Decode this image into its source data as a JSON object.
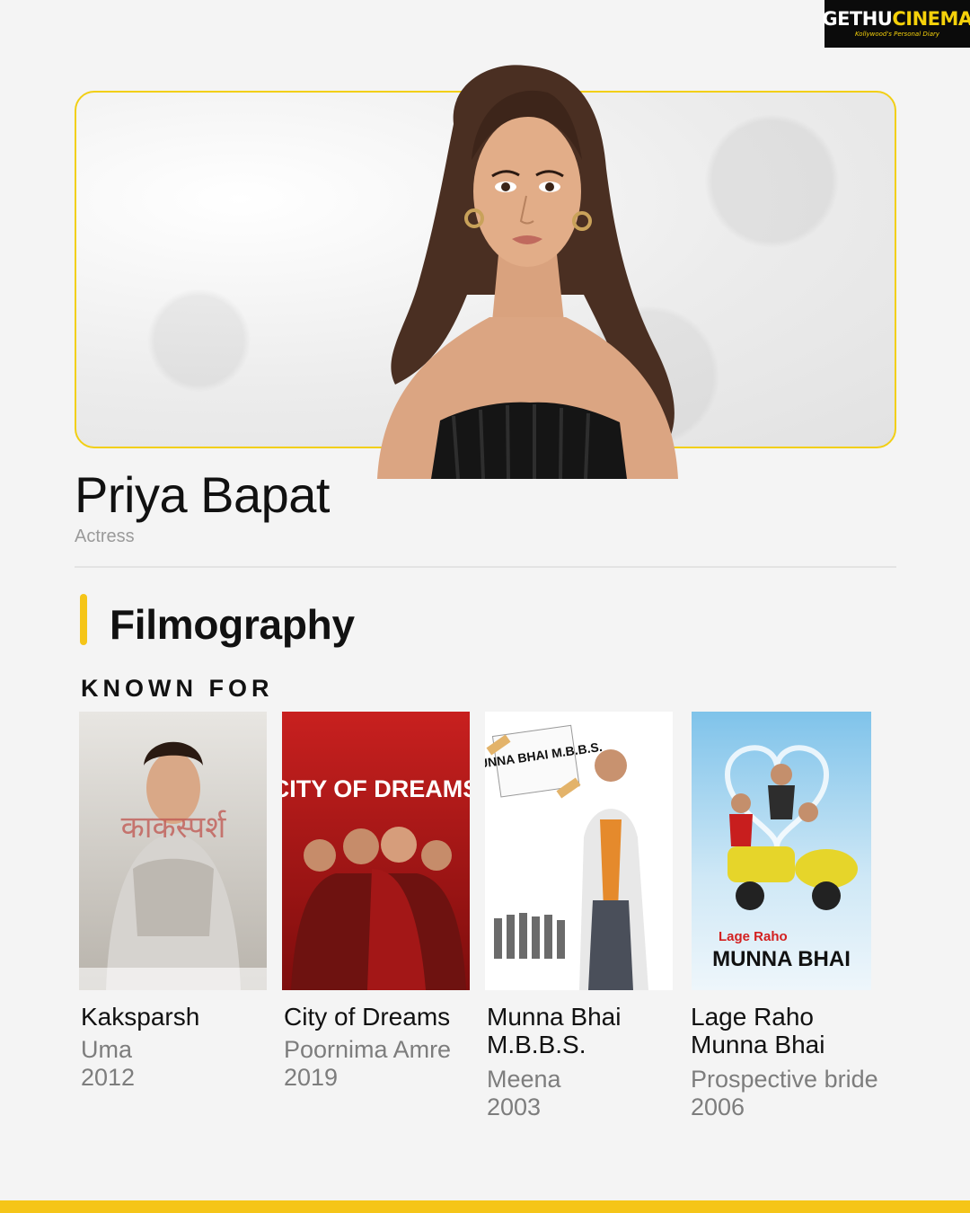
{
  "watermark": {
    "brand_part1": "GETHU",
    "brand_part2": "CINEMA",
    "tagline": "Kollywood's Personal Diary"
  },
  "person": {
    "name": "Priya Bapat",
    "role": "Actress"
  },
  "section": {
    "title": "Filmography",
    "subtitle": "KNOWN FOR"
  },
  "films": [
    {
      "title": "Kaksparsh",
      "role": "Uma",
      "year": "2012",
      "poster_text": "काकस्पर्श",
      "poster_colors": [
        "#e8e6e2",
        "#b8b3ab"
      ]
    },
    {
      "title": "City of Dreams",
      "role": "Poornima Amre",
      "year": "2019",
      "poster_text": "CITY OF DREAMS",
      "poster_colors": [
        "#c8201f",
        "#7e0d0d"
      ]
    },
    {
      "title": "Munna Bhai M.B.B.S.",
      "role": "Meena",
      "year": "2003",
      "poster_text": "MUNNA BHAI M.B.B.S.",
      "poster_colors": [
        "#ffffff",
        "#eaeaea"
      ]
    },
    {
      "title": "Lage Raho Munna Bhai",
      "role": "Prospective bride",
      "year": "2006",
      "poster_text_top": "Lage Raho",
      "poster_text": "MUNNA BHAI",
      "poster_colors": [
        "#7fc3ea",
        "#eef6fb"
      ]
    }
  ],
  "colors": {
    "accent": "#f5c518",
    "border": "#f2cf14",
    "muted": "#7d7d7d"
  }
}
